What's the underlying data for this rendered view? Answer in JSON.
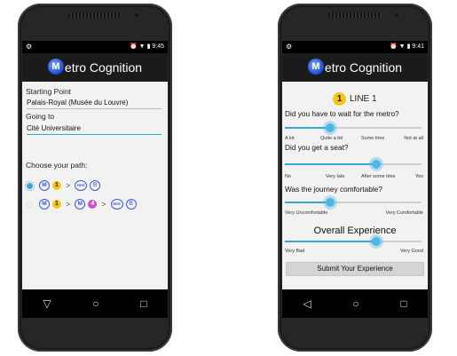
{
  "app": {
    "logo_letter": "M",
    "title": "etro Cognition"
  },
  "screen1": {
    "status_time": "9:45",
    "starting_label": "Starting Point",
    "starting_value": "Palais-Royal (Musée du Louvre)",
    "going_label": "Going to",
    "going_value": "Cité Universitaire",
    "choose_label": "Choose your path:",
    "path1": {
      "m": "M",
      "line": "1",
      "rer": "RER",
      "rer_line": "B",
      "selected": true
    },
    "path2": {
      "m1": "M",
      "line1": "1",
      "m2": "M",
      "line2": "4",
      "rer": "RER",
      "rer_line": "B",
      "selected": false
    },
    "arrow": ">"
  },
  "screen2": {
    "status_time": "9:41",
    "line_number": "1",
    "line_label": "LINE 1",
    "questions": [
      {
        "text": "Did you have to wait for the metro?",
        "value": 0.33,
        "ticks": [
          "A lot",
          "Quite a bit",
          "Some time",
          "Not at all"
        ]
      },
      {
        "text": "Did you get a seat?",
        "value": 0.67,
        "ticks": [
          "No",
          "Very late",
          "After some time",
          "Yes"
        ]
      },
      {
        "text": "Was the journey comfortable?",
        "value": 0.33,
        "ticks": [
          "Very Uncomfortable",
          "Very Comfortable"
        ]
      }
    ],
    "overall_label": "Overall Experience",
    "overall": {
      "value": 0.67,
      "ticks": [
        "Very Bad",
        "Very Good"
      ]
    },
    "submit_label": "Submit Your Experience"
  },
  "nav": {
    "back": "◁",
    "back_alt": "▽",
    "home": "○",
    "recents": "□"
  },
  "status": {
    "alarm": "⏰",
    "signal": "▼",
    "battery": "▮"
  },
  "colors": {
    "accent": "#35a6d6",
    "yellow": "#f6c617",
    "purple": "#c84fc2"
  }
}
